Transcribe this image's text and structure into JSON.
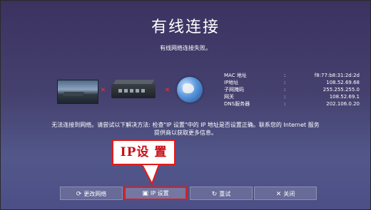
{
  "screen": {
    "title": "有线连接",
    "subtitle": "有线网络连接失败。"
  },
  "diagram": {
    "icons": [
      "tv-icon",
      "router-icon",
      "globe-icon"
    ],
    "status": "disconnected"
  },
  "network_info": [
    {
      "label": "MAC 地址",
      "value": "f8:77:b8:31:2d:2d"
    },
    {
      "label": "IP地址",
      "value": "108.52.69.68"
    },
    {
      "label": "子网掩码",
      "value": "255.255.255.0"
    },
    {
      "label": "网关",
      "value": "108.52.69.1"
    },
    {
      "label": "DNS服务器",
      "value": "202.106.0.20"
    }
  ],
  "hint": {
    "line1": "无法连接到网络。请尝试以下解决方法: 检查\"IP 设置\"中的 IP 地址是否设置正确。联系您的 Internet 服务",
    "line2": "提供商以获取更多信息。"
  },
  "callout": {
    "label": "IP设 置"
  },
  "buttons": [
    {
      "label": "更改网络",
      "icon": "change-network-icon"
    },
    {
      "label": "IP 设置",
      "icon": "ip-settings-icon",
      "focused": true
    },
    {
      "label": "重试",
      "icon": "retry-icon"
    },
    {
      "label": "关闭",
      "icon": "close-icon"
    }
  ],
  "colors": {
    "accent": "#e21b1b",
    "background": "#45416f"
  }
}
